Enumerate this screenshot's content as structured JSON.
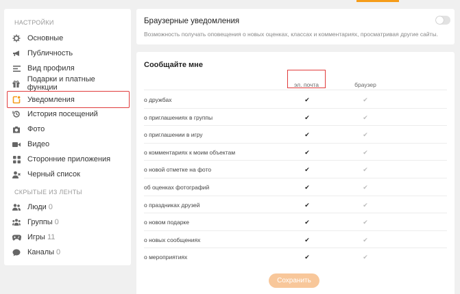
{
  "sidebar": {
    "section_settings": "НАСТРОЙКИ",
    "items": [
      {
        "label": "Основные",
        "icon": "gear-icon"
      },
      {
        "label": "Публичность",
        "icon": "megaphone-icon"
      },
      {
        "label": "Вид профиля",
        "icon": "profile-view-icon"
      },
      {
        "label": "Подарки и платные функции",
        "icon": "gift-icon"
      },
      {
        "label": "Уведомления",
        "icon": "notification-icon"
      },
      {
        "label": "История посещений",
        "icon": "history-icon"
      },
      {
        "label": "Фото",
        "icon": "camera-icon"
      },
      {
        "label": "Видео",
        "icon": "video-icon"
      },
      {
        "label": "Сторонние приложения",
        "icon": "apps-icon"
      },
      {
        "label": "Черный список",
        "icon": "blacklist-icon"
      }
    ],
    "section_hidden": "СКРЫТЫЕ ИЗ ЛЕНТЫ",
    "hidden": [
      {
        "label": "Люди",
        "count": "0",
        "icon": "people-icon"
      },
      {
        "label": "Группы",
        "count": "0",
        "icon": "groups-icon"
      },
      {
        "label": "Игры",
        "count": "11",
        "icon": "gamepad-icon"
      },
      {
        "label": "Каналы",
        "count": "0",
        "icon": "channels-icon"
      }
    ]
  },
  "browser_notifications": {
    "title": "Браузерные уведомления",
    "description": "Возможность получать оповещения о новых оценках, классах и комментариях, просматривая другие сайты.",
    "enabled": false
  },
  "notify": {
    "title": "Сообщайте мне",
    "col_email": "эл. почта",
    "col_browser": "браузер",
    "rows": [
      {
        "label": "о дружбах",
        "email": true,
        "browser": true
      },
      {
        "label": "о приглашениях в группы",
        "email": true,
        "browser": true
      },
      {
        "label": "о приглашении в игру",
        "email": true,
        "browser": true
      },
      {
        "label": "о комментариях к моим объектам",
        "email": true,
        "browser": true
      },
      {
        "label": "о новой отметке на фото",
        "email": true,
        "browser": true
      },
      {
        "label": "об оценках фотографий",
        "email": true,
        "browser": true
      },
      {
        "label": "о праздниках друзей",
        "email": true,
        "browser": true
      },
      {
        "label": "о новом подарке",
        "email": true,
        "browser": true
      },
      {
        "label": "о новых сообщениях",
        "email": true,
        "browser": true
      },
      {
        "label": "о мероприятиях",
        "email": true,
        "browser": true
      }
    ],
    "save_label": "Сохранить"
  },
  "colors": {
    "accent": "#f59c1a",
    "highlight": "#e03a3a",
    "save_button": "#f8c79a"
  }
}
